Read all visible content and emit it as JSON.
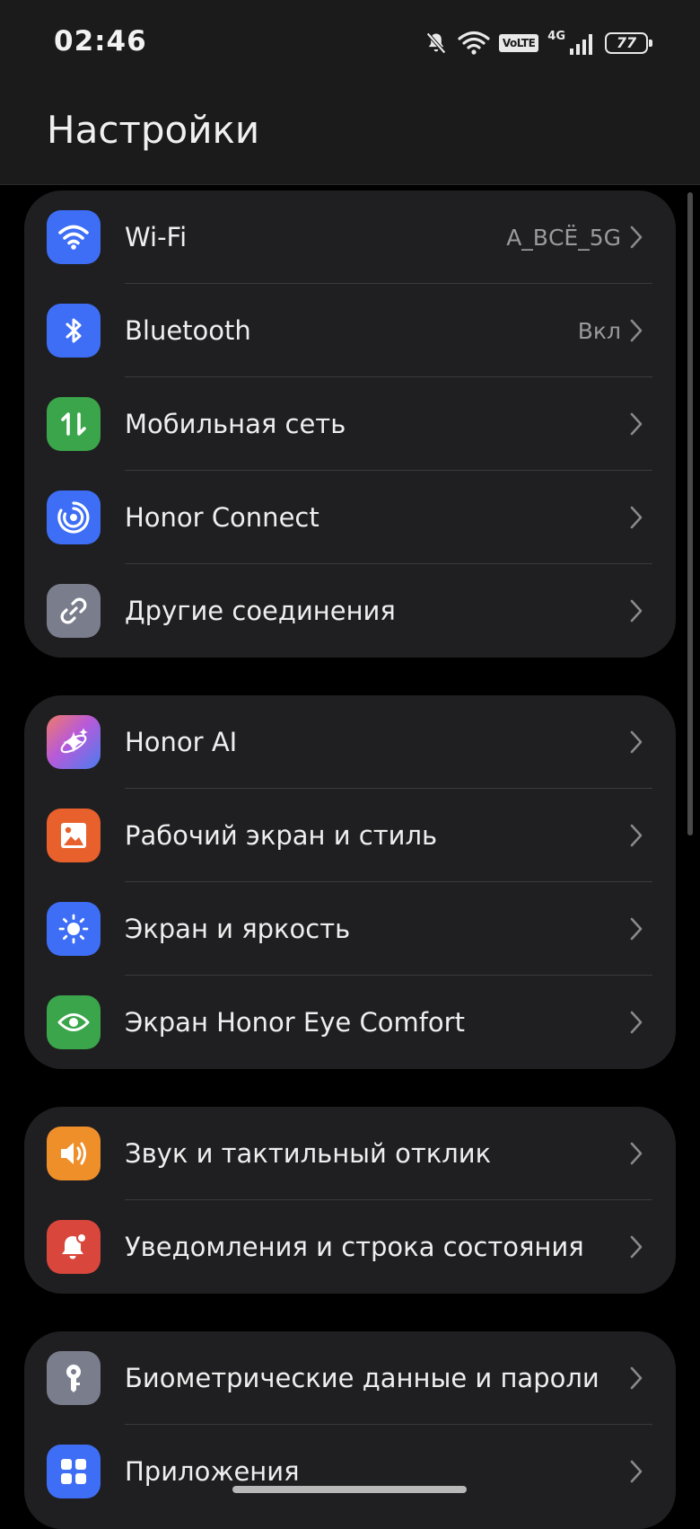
{
  "status_bar": {
    "time": "02:46",
    "volte": "VoLTE",
    "network_type": "4G",
    "battery": "77"
  },
  "page": {
    "title": "Настройки"
  },
  "groups": [
    {
      "items": [
        {
          "label": "Wi-Fi",
          "value": "A_ВСЁ_5G",
          "icon": "wifi-icon",
          "color": "#3d6ef5"
        },
        {
          "label": "Bluetooth",
          "value": "Вкл",
          "icon": "bluetooth-icon",
          "color": "#3d6ef5"
        },
        {
          "label": "Мобильная сеть",
          "value": "",
          "icon": "mobile-data-icon",
          "color": "#3aa54a"
        },
        {
          "label": "Honor Connect",
          "value": "",
          "icon": "honor-connect-icon",
          "color": "#3d6ef5"
        },
        {
          "label": "Другие соединения",
          "value": "",
          "icon": "link-icon",
          "color": "#7a7d8c"
        }
      ]
    },
    {
      "items": [
        {
          "label": "Honor AI",
          "value": "",
          "icon": "sparkle-icon",
          "color": "#8a5ad8"
        },
        {
          "label": "Рабочий экран и стиль",
          "value": "",
          "icon": "image-icon",
          "color": "#e8602c"
        },
        {
          "label": "Экран и яркость",
          "value": "",
          "icon": "sun-icon",
          "color": "#3d6ef5"
        },
        {
          "label": "Экран Honor Eye Comfort",
          "value": "",
          "icon": "eye-icon",
          "color": "#3aa54a"
        }
      ]
    },
    {
      "items": [
        {
          "label": "Звук и тактильный отклик",
          "value": "",
          "icon": "speaker-icon",
          "color": "#ef8f2a"
        },
        {
          "label": "Уведомления и строка состояния",
          "value": "",
          "icon": "bell-icon",
          "color": "#d9463c"
        }
      ]
    },
    {
      "items": [
        {
          "label": "Биометрические данные и пароли",
          "value": "",
          "icon": "key-icon",
          "color": "#7a7d8c"
        },
        {
          "label": "Приложения",
          "value": "",
          "icon": "apps-grid-icon",
          "color": "#3d6ef5"
        }
      ]
    }
  ]
}
